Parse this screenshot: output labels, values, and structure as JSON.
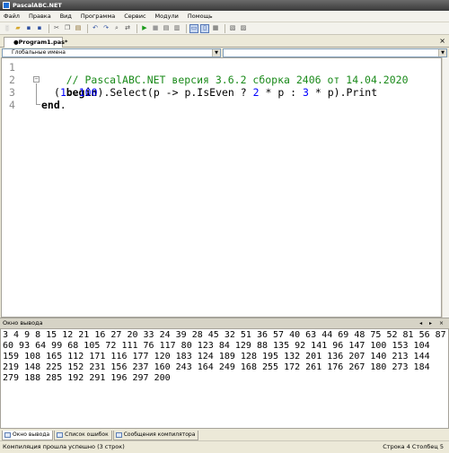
{
  "window": {
    "title": "PascalABC.NET"
  },
  "menu": [
    "Файл",
    "Правка",
    "Вид",
    "Программа",
    "Сервис",
    "Модули",
    "Помощь"
  ],
  "toolbar": {
    "icons": [
      "new-file-icon",
      "open-icon",
      "save-icon",
      "save-all-icon",
      "cut-icon",
      "copy-icon",
      "paste-icon",
      "undo-icon",
      "redo-icon",
      "find-icon",
      "replace-icon",
      "run-icon",
      "stop-icon",
      "step-icon",
      "debug-icon",
      "output-panel-icon",
      "split-icon",
      "format-icon",
      "settings-icon",
      "help-icon"
    ]
  },
  "tab": {
    "label": "●Program1.pas*",
    "close": "×"
  },
  "combos": {
    "left": "Глобальные имена",
    "right": ""
  },
  "editor": {
    "line_numbers": [
      "1",
      "2",
      "3",
      "4"
    ],
    "line1": {
      "comment": "// PascalABC.NET версия 3.6.2 сборка 2406 от 14.04.2020"
    },
    "line2": {
      "kw": "begin"
    },
    "line3": {
      "p1": "(",
      "n1": "1",
      "p2": "..",
      "n2": "100",
      "p3": ").Select(p -> p.IsEven ? ",
      "n3": "2",
      "p4": " * p : ",
      "n4": "3",
      "p5": " * p).Print"
    },
    "line4": {
      "kw": "end",
      "p": "."
    }
  },
  "output": {
    "header": "Окно вывода",
    "controls": "◂ ▸ × ",
    "text": "3 4 9 8 15 12 21 16 27 20 33 24 39 28 45 32 51 36 57 40 63 44 69 48 75 52 81 56 87 60 93 64 99 68 105 72 111 76 117 80 123 84 129 88 135 92 141 96 147 100 153 104 159 108 165 112 171 116 177 120 183 124 189 128 195 132 201 136 207 140 213 144 219 148 225 152 231 156 237 160 243 164 249 168 255 172 261 176 267 180 273 184 279 188 285 192 291 196 297 200"
  },
  "bottom_tabs": [
    "Окно вывода",
    "Список ошибок",
    "Сообщения компилятора"
  ],
  "status": {
    "message": "Компиляция прошла успешно (3 строк)",
    "position": "Строка  4 Столбец  5"
  }
}
